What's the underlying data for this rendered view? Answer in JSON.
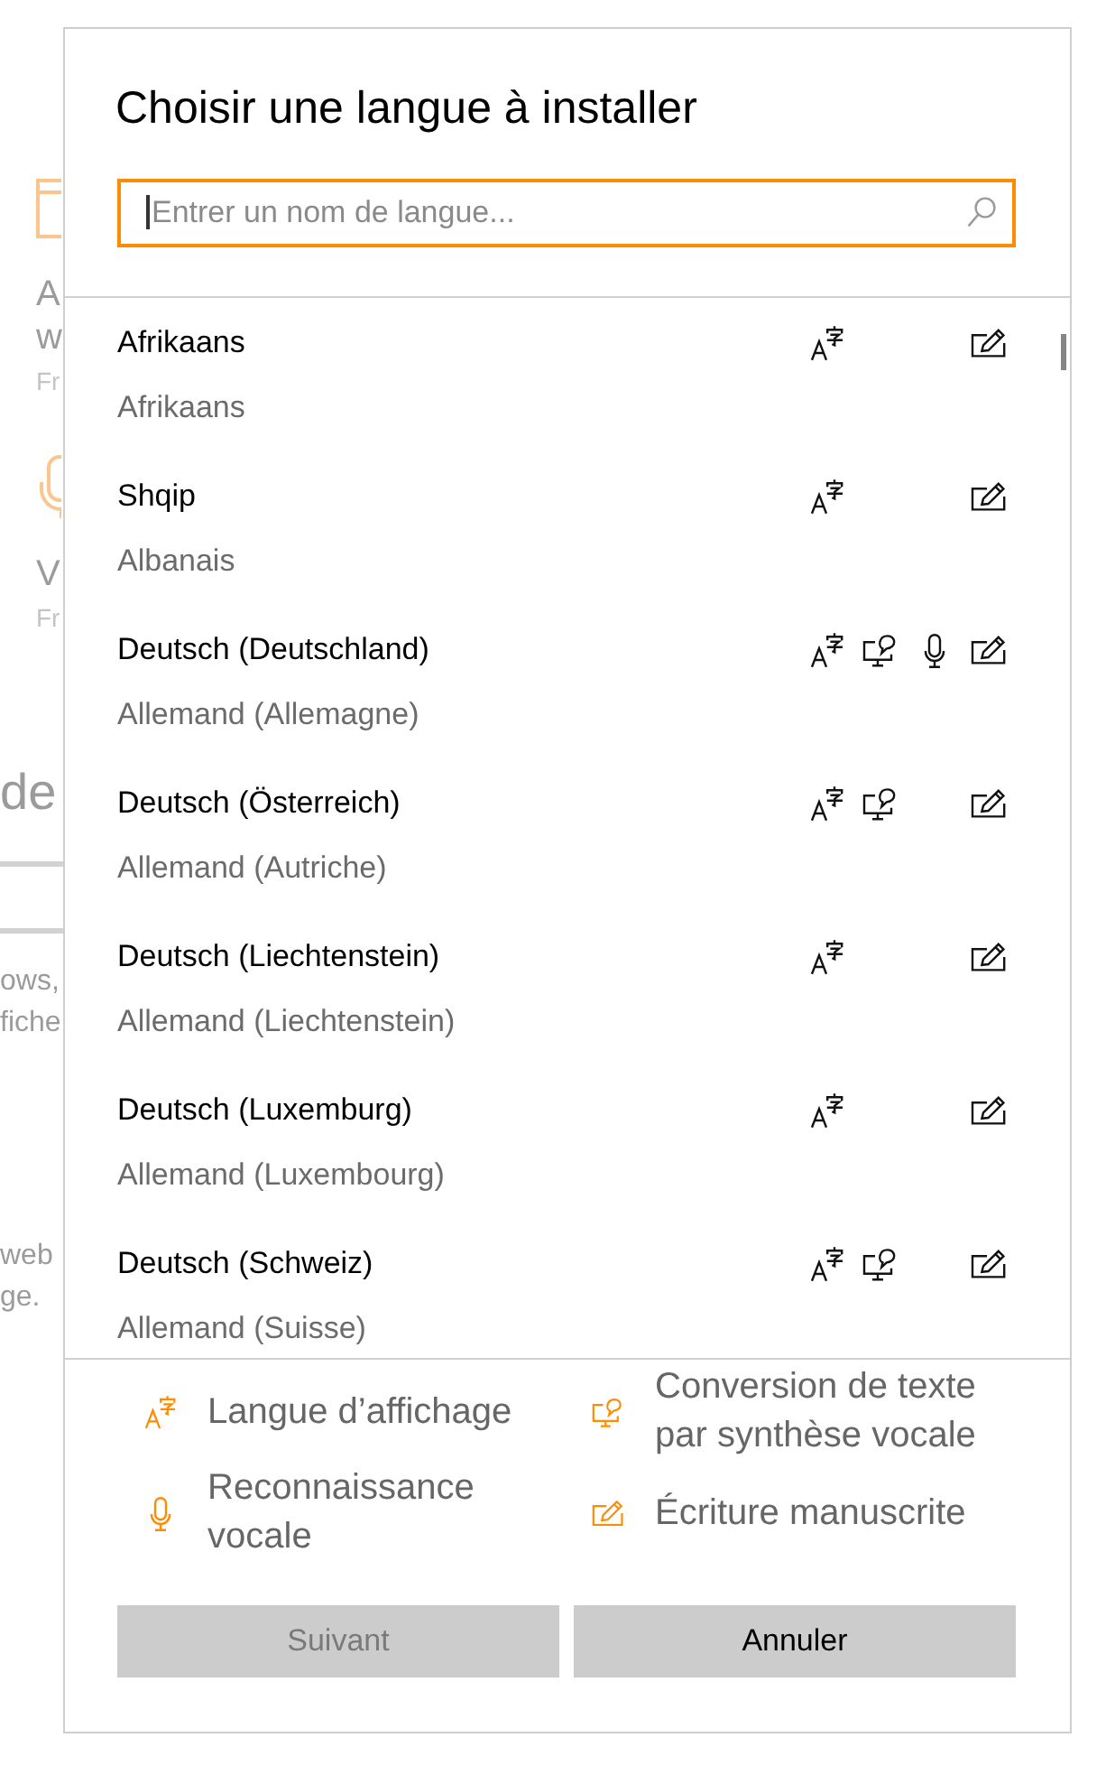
{
  "background_page": {
    "tiles": [
      {
        "kind": "window",
        "title_lines": [
          "A",
          "w"
        ],
        "subtitle": "Fr"
      },
      {
        "kind": "microphone",
        "title_lines": [
          "V"
        ],
        "subtitle": "Fr"
      }
    ],
    "heading": "de",
    "paragraphs": [
      [
        "ows,",
        "fiche"
      ],
      [
        "web",
        "ge."
      ]
    ]
  },
  "dialog": {
    "title": "Choisir une langue à installer",
    "search": {
      "placeholder": "Entrer un nom de langue..."
    },
    "languages": [
      {
        "name": "Afrikaans",
        "translation": "Afrikaans",
        "display_language": true,
        "text_to_speech": false,
        "speech_recognition": false,
        "handwriting": true
      },
      {
        "name": "Shqip",
        "translation": "Albanais",
        "display_language": true,
        "text_to_speech": false,
        "speech_recognition": false,
        "handwriting": true
      },
      {
        "name": "Deutsch (Deutschland)",
        "translation": "Allemand (Allemagne)",
        "display_language": true,
        "text_to_speech": true,
        "speech_recognition": true,
        "handwriting": true
      },
      {
        "name": "Deutsch (Österreich)",
        "translation": "Allemand (Autriche)",
        "display_language": true,
        "text_to_speech": true,
        "speech_recognition": false,
        "handwriting": true
      },
      {
        "name": "Deutsch (Liechtenstein)",
        "translation": "Allemand (Liechtenstein)",
        "display_language": true,
        "text_to_speech": false,
        "speech_recognition": false,
        "handwriting": true
      },
      {
        "name": "Deutsch (Luxemburg)",
        "translation": "Allemand (Luxembourg)",
        "display_language": true,
        "text_to_speech": false,
        "speech_recognition": false,
        "handwriting": true
      },
      {
        "name": "Deutsch (Schweiz)",
        "translation": "Allemand (Suisse)",
        "display_language": true,
        "text_to_speech": true,
        "speech_recognition": false,
        "handwriting": true
      }
    ],
    "legend": [
      {
        "kind": "display_language",
        "label": "Langue d’affichage"
      },
      {
        "kind": "speech_recognition",
        "label": "Reconnaissance vocale"
      },
      {
        "kind": "text_to_speech",
        "label": "Conversion de texte par synthèse vocale"
      },
      {
        "kind": "handwriting",
        "label": "Écriture manuscrite"
      }
    ],
    "buttons": [
      {
        "label": "Suivant",
        "disabled": true
      },
      {
        "label": "Annuler",
        "disabled": false
      }
    ]
  }
}
